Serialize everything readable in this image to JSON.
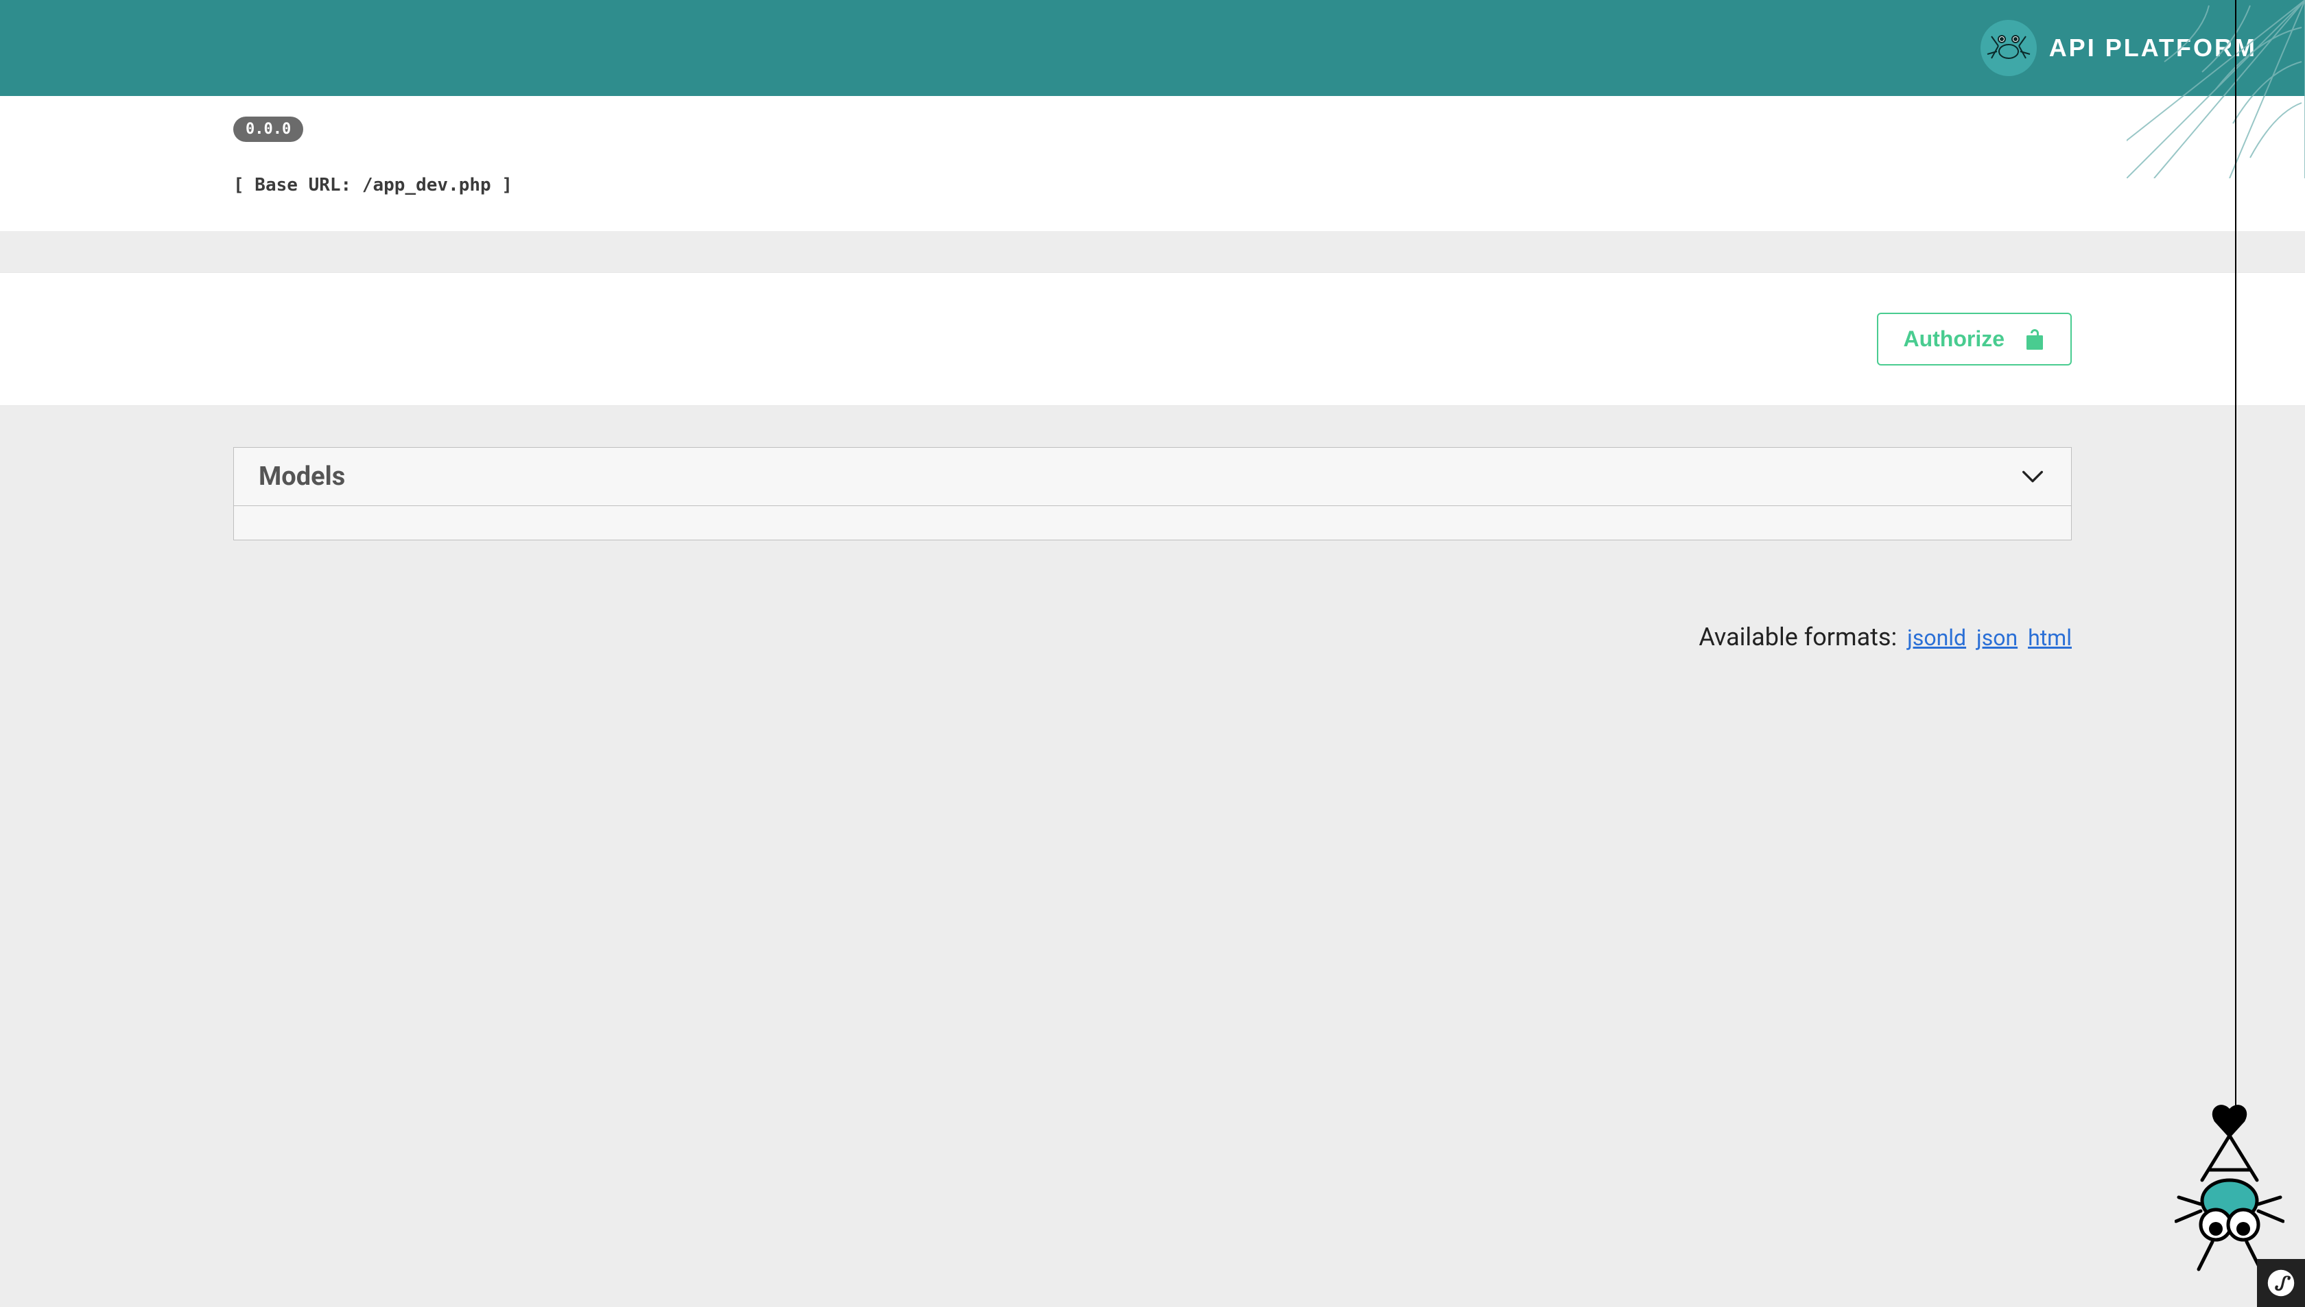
{
  "brand": {
    "text": "API PLATFORM"
  },
  "info": {
    "version": "0.0.0",
    "base_url_label": "[ Base URL: /app_dev.php ]"
  },
  "authorize": {
    "label": "Authorize"
  },
  "models": {
    "title": "Models"
  },
  "formats": {
    "label": "Available formats:",
    "links": [
      "jsonld",
      "json",
      "html"
    ]
  }
}
